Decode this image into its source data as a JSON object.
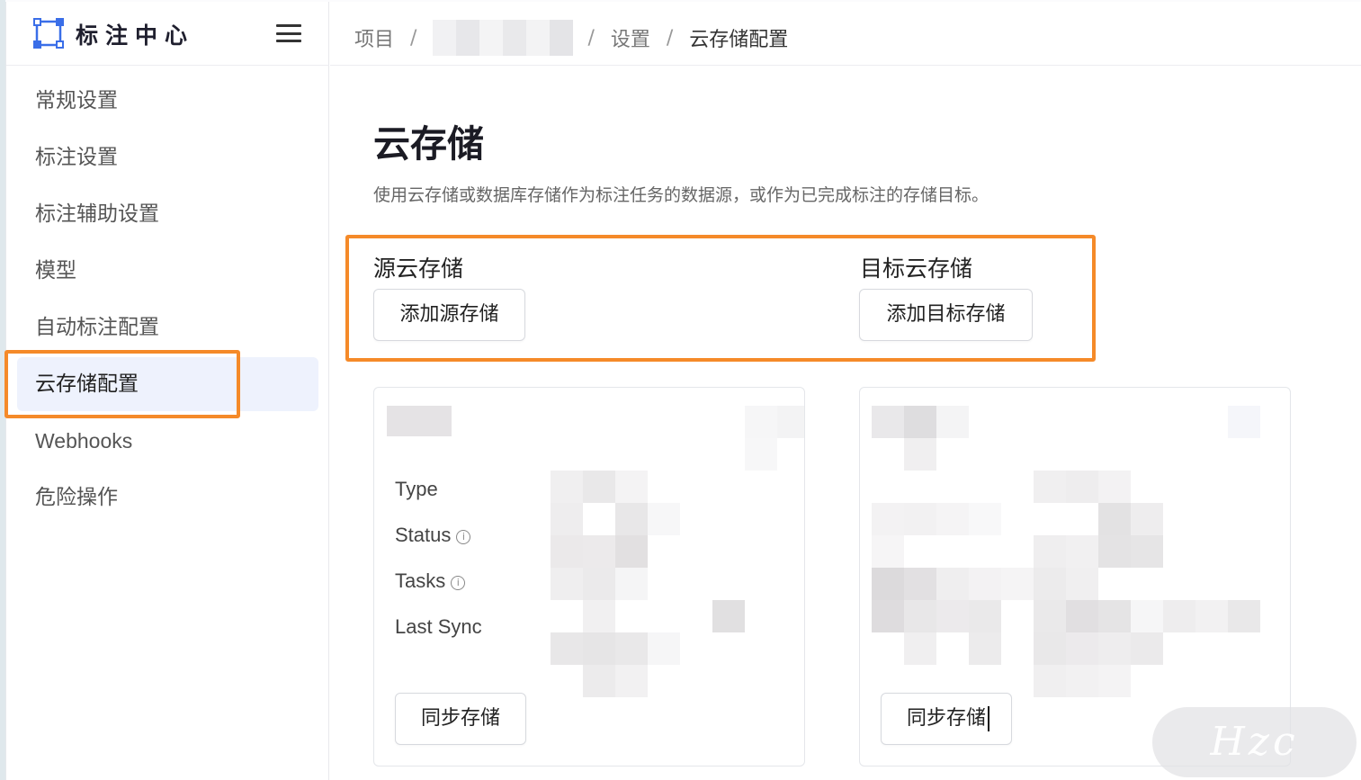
{
  "brand": {
    "title": "标注中心",
    "logo_icon": "bounding-box-icon",
    "accent": "#3a6ee8"
  },
  "breadcrumb": {
    "items": [
      "项目",
      "设置",
      "云存储配置"
    ],
    "separator": "/"
  },
  "sidebar": {
    "items": [
      {
        "label": "常规设置"
      },
      {
        "label": "标注设置"
      },
      {
        "label": "标注辅助设置"
      },
      {
        "label": "模型"
      },
      {
        "label": "自动标注配置"
      },
      {
        "label": "云存储配置",
        "active": true
      },
      {
        "label": "Webhooks"
      },
      {
        "label": "危险操作"
      }
    ]
  },
  "main": {
    "title": "云存储",
    "description": "使用云存储或数据库存储作为标注任务的数据源，或作为已完成标注的存储目标。",
    "source": {
      "label": "源云存储",
      "add_button": "添加源存储"
    },
    "target": {
      "label": "目标云存储",
      "add_button": "添加目标存储"
    },
    "cards": [
      {
        "fields": {
          "type": "Type",
          "status": "Status",
          "tasks": "Tasks",
          "last_sync": "Last Sync"
        },
        "sync_button": "同步存储"
      },
      {
        "sync_button": "同步存储"
      }
    ]
  },
  "colors": {
    "highlight": "#f58a29",
    "active_bg": "#eef2fd"
  },
  "watermark": {
    "text": "Hzc"
  }
}
